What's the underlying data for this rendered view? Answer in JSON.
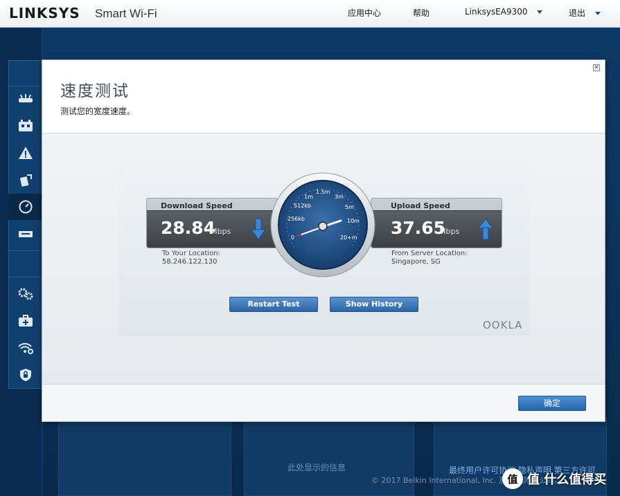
{
  "header": {
    "logo": "LINKSYS",
    "product": "Smart Wi-Fi",
    "nav": {
      "app_center": "应用中心",
      "help": "帮助",
      "device": "LinksysEA9300",
      "logout": "退出"
    }
  },
  "sidebar": {
    "icons": [
      "router-icon",
      "devices-icon",
      "alert-icon",
      "external-storage-icon",
      "speedometer-icon",
      "usb-icon",
      "gear-icon",
      "medical-kit-icon",
      "wifi-settings-icon",
      "security-icon"
    ],
    "active": "speedometer-icon"
  },
  "modal": {
    "title": "速度测试",
    "subtitle": "测试您的宽度速度。",
    "close_glyph": "✕",
    "ok_button": "确定"
  },
  "speedtest": {
    "download": {
      "label": "Download Speed",
      "value": "28.84",
      "unit": "Mbps",
      "location_label": "To Your Location:",
      "location_value": "58.246.122.130"
    },
    "upload": {
      "label": "Upload Speed",
      "value": "37.65",
      "unit": "Mbps",
      "location_label": "From Server Location:",
      "location_value": "Singapore, SG"
    },
    "gauge_labels": [
      "0",
      "256kb",
      "512kb",
      "1m",
      "1.5m",
      "3m",
      "5m",
      "10m",
      "20+m"
    ],
    "restart_button": "Restart Test",
    "history_button": "Show History",
    "brand": "OOKLA"
  },
  "footer": {
    "links": "最终用户许可协议  隐私声明  第三方许可",
    "copyright": "© 2017 Belkin International, Inc. 及/或其附属公司。",
    "watermark": "值 什么值得买"
  },
  "background": {
    "card_text": "此处显示的信息"
  },
  "colors": {
    "accent_blue": "#2d65a4",
    "sidebar_bg": "#0b2c50",
    "download_arrow": "#3f86d4",
    "upload_arrow": "#3f86d4"
  }
}
